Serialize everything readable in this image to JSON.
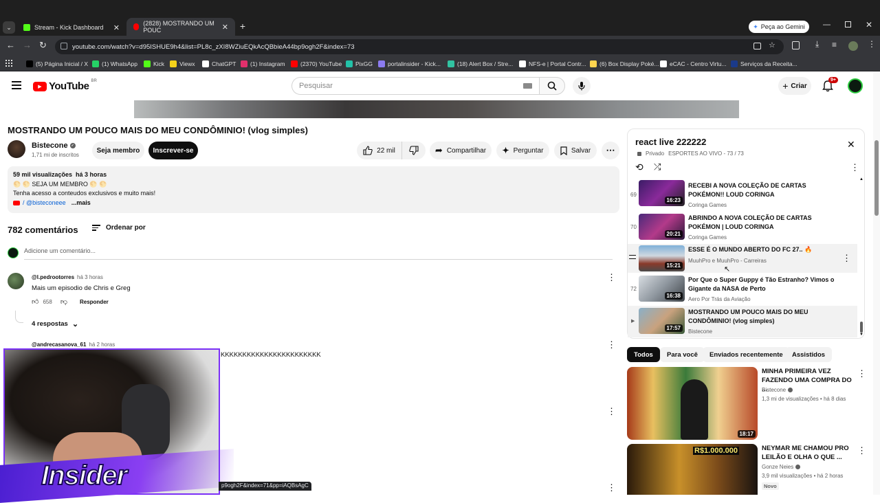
{
  "browser": {
    "tabs": [
      {
        "label": "Stream - Kick Dashboard",
        "close": "✕"
      },
      {
        "label": "(2828) MOSTRANDO UM POUC",
        "close": "✕"
      }
    ],
    "new_tab": "+",
    "gemini_button": "Peça ao Gemini",
    "url": "youtube.com/watch?v=d95ISHUE9h4&list=PL8c_zXI8WZiuEQkAcQBbieA44bp9ogh2F&index=73",
    "bookmarks": [
      {
        "label": "(5) Página Inicial / X",
        "color": "#000000"
      },
      {
        "label": "(1) WhatsApp",
        "color": "#25d366"
      },
      {
        "label": "Kick",
        "color": "#53fc18"
      },
      {
        "label": "Viewx",
        "color": "#f5d21a"
      },
      {
        "label": "ChatGPT",
        "color": "#ffffff"
      },
      {
        "label": "(1) Instagram",
        "color": "#e1306c"
      },
      {
        "label": "(2370) YouTube",
        "color": "#ff0000"
      },
      {
        "label": "PixGG",
        "color": "#22c1a8"
      },
      {
        "label": "portalinsider - Kick...",
        "color": "#8c7cf0"
      },
      {
        "label": "(18) Alert Box / Stre...",
        "color": "#31c3a2"
      },
      {
        "label": "NFS-e | Portal Contr...",
        "color": "#ffffff"
      },
      {
        "label": "(6) Box Display Poké...",
        "color": "#ffd54f"
      },
      {
        "label": "eCAC - Centro Virtu...",
        "color": "#ffffff"
      },
      {
        "label": "Serviços da Receita...",
        "color": "#1b3a8a"
      }
    ]
  },
  "yt_header": {
    "logo_text": "YouTube",
    "region": "BR",
    "search_placeholder": "Pesquisar",
    "create_label": "Criar",
    "notif_count": "9+"
  },
  "video": {
    "title": "MOSTRANDO UM POUCO MAIS DO MEU CONDÔMINIO! (vlog simples)",
    "channel": "Bistecone",
    "subscribers": "1,71 mi de inscritos",
    "member_label": "Seja membro",
    "subscribe_label": "Inscrever-se",
    "likes": "22 mil",
    "share_label": "Compartilhar",
    "ask_label": "Perguntar",
    "save_label": "Salvar"
  },
  "description": {
    "stats": "59 mil visualizações  há 3 horas",
    "line1": "🌕 🌕 SEJA UM MEMBRO 🌕 🌕",
    "line2": "Tenha acesso a conteudos exclusivos e muito mais!",
    "line3": "/ @bisteconeee",
    "more": "...mais"
  },
  "comments": {
    "count_label": "782 comentários",
    "sort_label": "Ordenar por",
    "add_placeholder": "Adicione um comentário...",
    "items": [
      {
        "author": "@l.pedrootorres",
        "time": "há 3 horas",
        "text": "Mais um episodio de Chris e Greg",
        "likes": "658",
        "reply": "Responder",
        "replies": "4 respostas"
      },
      {
        "author": "@andrecasanova_61",
        "time": "há 2 horas",
        "text": "KKKKKKKKKKKKKKKKKKKKKKK"
      }
    ]
  },
  "status_url": "p9ogh2F&index=71&pp=iAQBsAgC",
  "overlay_text": "Insider",
  "playlist": {
    "title": "react live 222222",
    "privacy": "Privado",
    "meta": "ESPORTES AO VIVO - 73 / 73",
    "items": [
      {
        "num": "69",
        "title": "RECEBI A NOVA COLEÇÃO DE CARTAS POKÉMON!! LOUD CORINGA",
        "channel": "Coringa Games",
        "duration": "16:23"
      },
      {
        "num": "70",
        "title": "ABRINDO A NOVA COLEÇÃO DE CARTAS POKÉMON | LOUD CORINGA",
        "channel": "Coringa Games",
        "duration": "20:21"
      },
      {
        "num": "",
        "title": "ESSE É O MUNDO ABERTO DO FC 27.. 🔥",
        "channel": "MuuhPro e MuuhPro - Carreiras",
        "duration": "15:21"
      },
      {
        "num": "72",
        "title": "Por Que o Super Guppy é Tão Estranho? Vimos o Gigante da NASA de Perto",
        "channel": "Aero Por Trás da Aviação",
        "duration": "16:38"
      },
      {
        "num": "",
        "title": "MOSTRANDO UM POUCO MAIS DO MEU CONDÔMINIO! (vlog simples)",
        "channel": "Bistecone",
        "duration": "17:57"
      }
    ]
  },
  "chips": [
    "Todos",
    "Para você",
    "Enviados recentemente",
    "Assistidos"
  ],
  "recommended": [
    {
      "title": "MINHA PRIMEIRA VEZ FAZENDO UMA COMPRA DO ...",
      "channel": "Bistecone",
      "meta": "1,3 mi de visualizações • há 8 dias",
      "duration": "18:17"
    },
    {
      "title": "NEYMAR ME CHAMOU PRO LEILÃO E OLHA O QUE ...",
      "channel": "Gonze Neies",
      "meta": "3,9 mil visualizações • há 2 horas",
      "badge": "Novo",
      "banner": "R$1.000.000"
    }
  ]
}
